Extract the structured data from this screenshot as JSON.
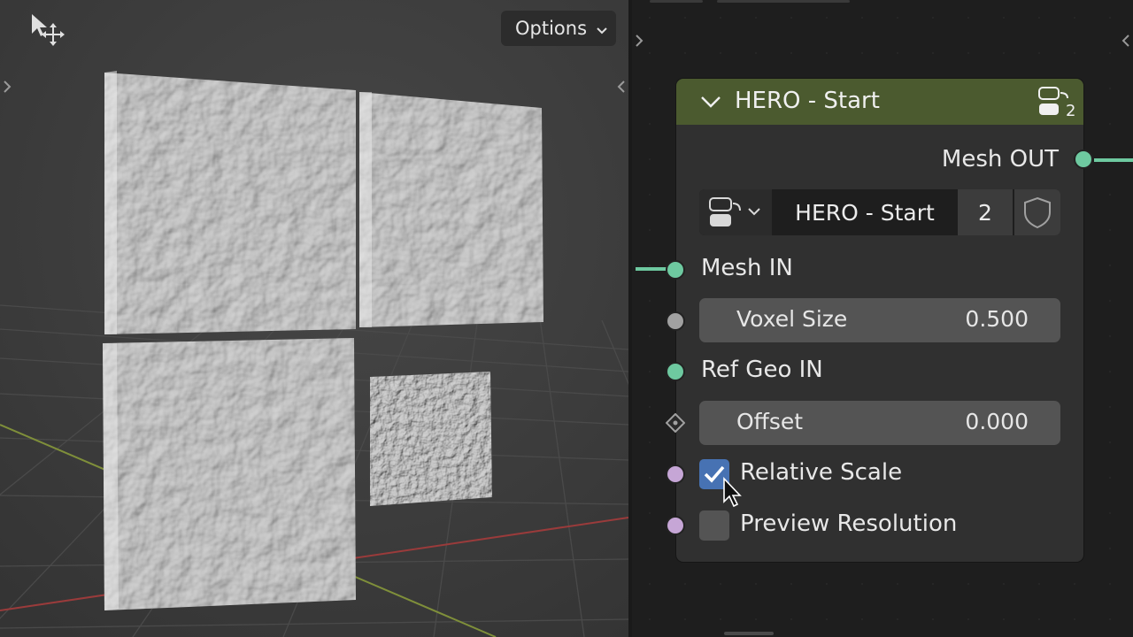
{
  "viewport": {
    "options_label": "Options"
  },
  "node": {
    "header_title": "HERO - Start",
    "header_user_count": "2",
    "output_label": "Mesh OUT",
    "group_selector": {
      "name": "HERO - Start",
      "user_count": "2"
    },
    "inputs": {
      "mesh_in": "Mesh IN",
      "voxel_size": {
        "label": "Voxel Size",
        "value": "0.500"
      },
      "ref_geo_in": "Ref Geo IN",
      "offset": {
        "label": "Offset",
        "value": "0.000"
      },
      "relative_scale": {
        "label": "Relative Scale",
        "checked": true
      },
      "preview_resolution": {
        "label": "Preview Resolution",
        "checked": false
      }
    },
    "colors": {
      "header": "#4b5a2f",
      "geometry_socket": "#6ec9a0",
      "float_socket": "#a1a1a1",
      "bool_socket": "#c6a6d6",
      "checkbox_on": "#4772b3"
    }
  },
  "icons": [
    "select-move-icon",
    "chevron-down-icon",
    "node-tree-icon",
    "shield-icon",
    "checkmark-icon",
    "mouse-cursor-icon"
  ]
}
